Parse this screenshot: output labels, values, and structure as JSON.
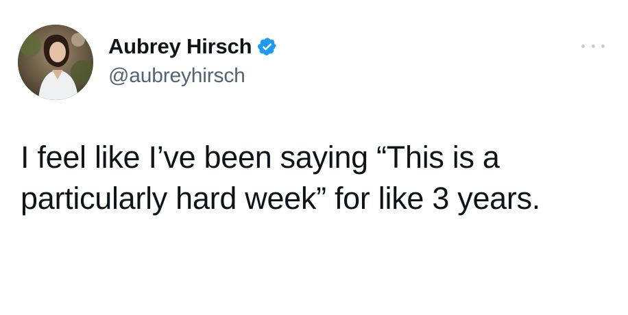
{
  "author": {
    "display_name": "Aubrey Hirsch",
    "handle": "@aubreyhirsch",
    "verified": true,
    "avatar_icon": "profile-photo"
  },
  "menu_icon": "more-options-icon",
  "tweet": {
    "lines": [
      "I feel like I’ve been saying “This is a",
      "particularly hard week” for like 3 years."
    ]
  },
  "colors": {
    "verified_badge": "#1d9bf0",
    "handle_text": "#536471",
    "body_text": "#0f1419",
    "menu_dots": "#c6ccd1"
  }
}
